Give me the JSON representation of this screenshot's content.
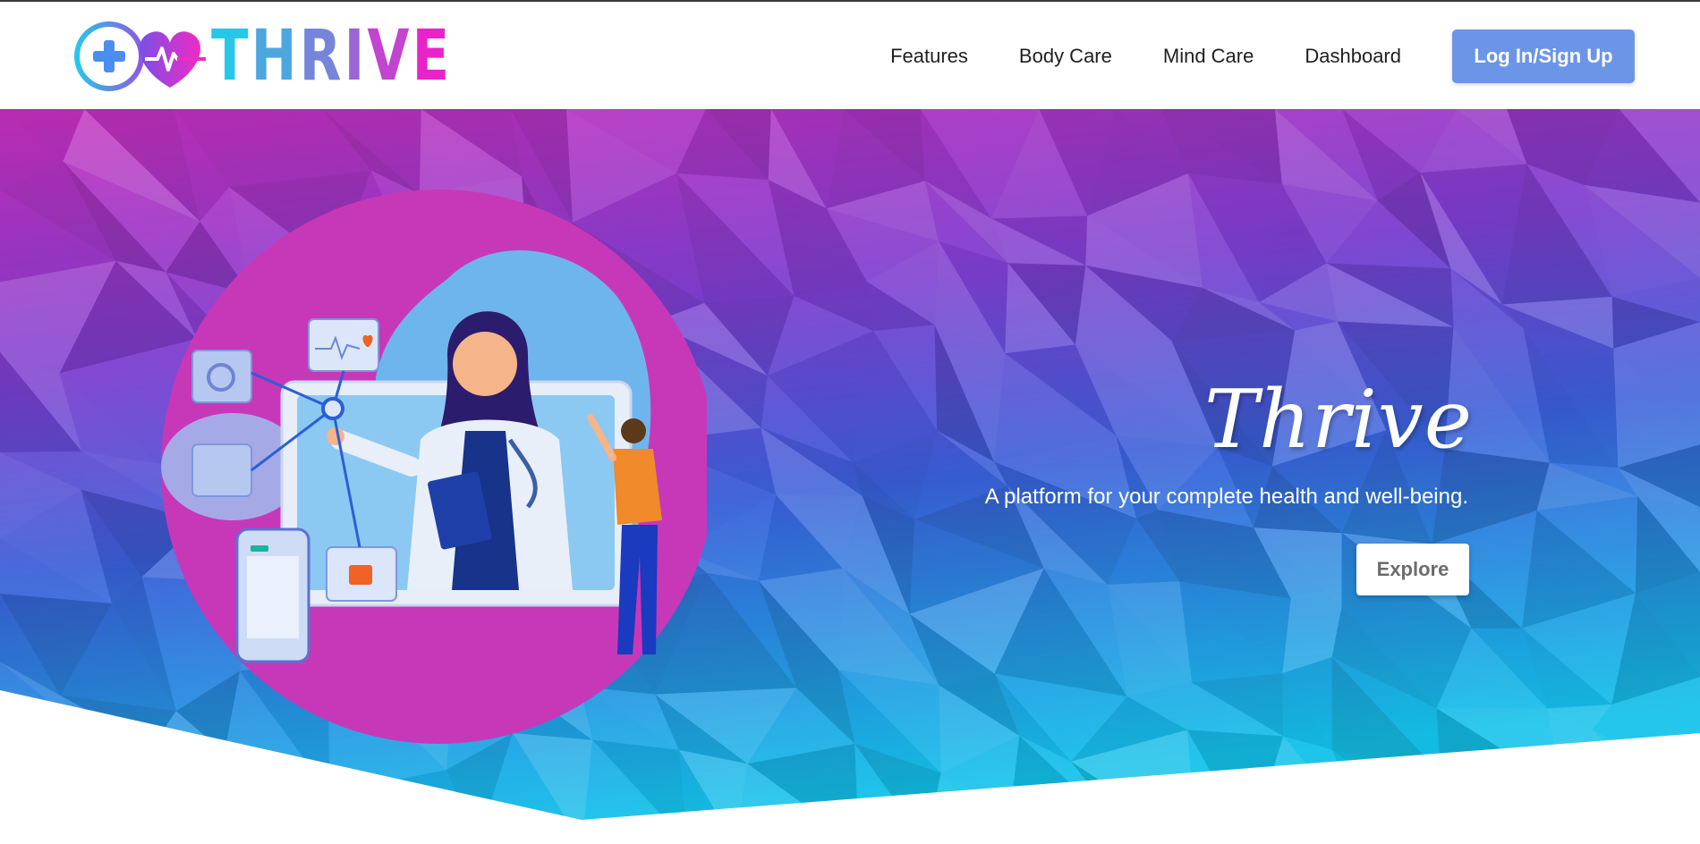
{
  "header": {
    "logo_text": "THRIVE",
    "nav": {
      "features": "Features",
      "body_care": "Body Care",
      "mind_care": "Mind Care",
      "dashboard": "Dashboard"
    },
    "login_label": "Log In/Sign Up"
  },
  "hero": {
    "title": "Thrive",
    "subtitle": "A platform for your complete health and well-being.",
    "explore_label": "Explore"
  },
  "icons": {
    "logo": "medical-cross-heart-pulse-icon",
    "illustration": "doctor-telehealth-illustration"
  },
  "colors": {
    "login_button": "#6b95e6",
    "logo_gradient_start": "#27c7e6",
    "logo_gradient_end": "#e923c9",
    "hero_top": "#c02fc0",
    "hero_bottom": "#1ab8e8"
  }
}
